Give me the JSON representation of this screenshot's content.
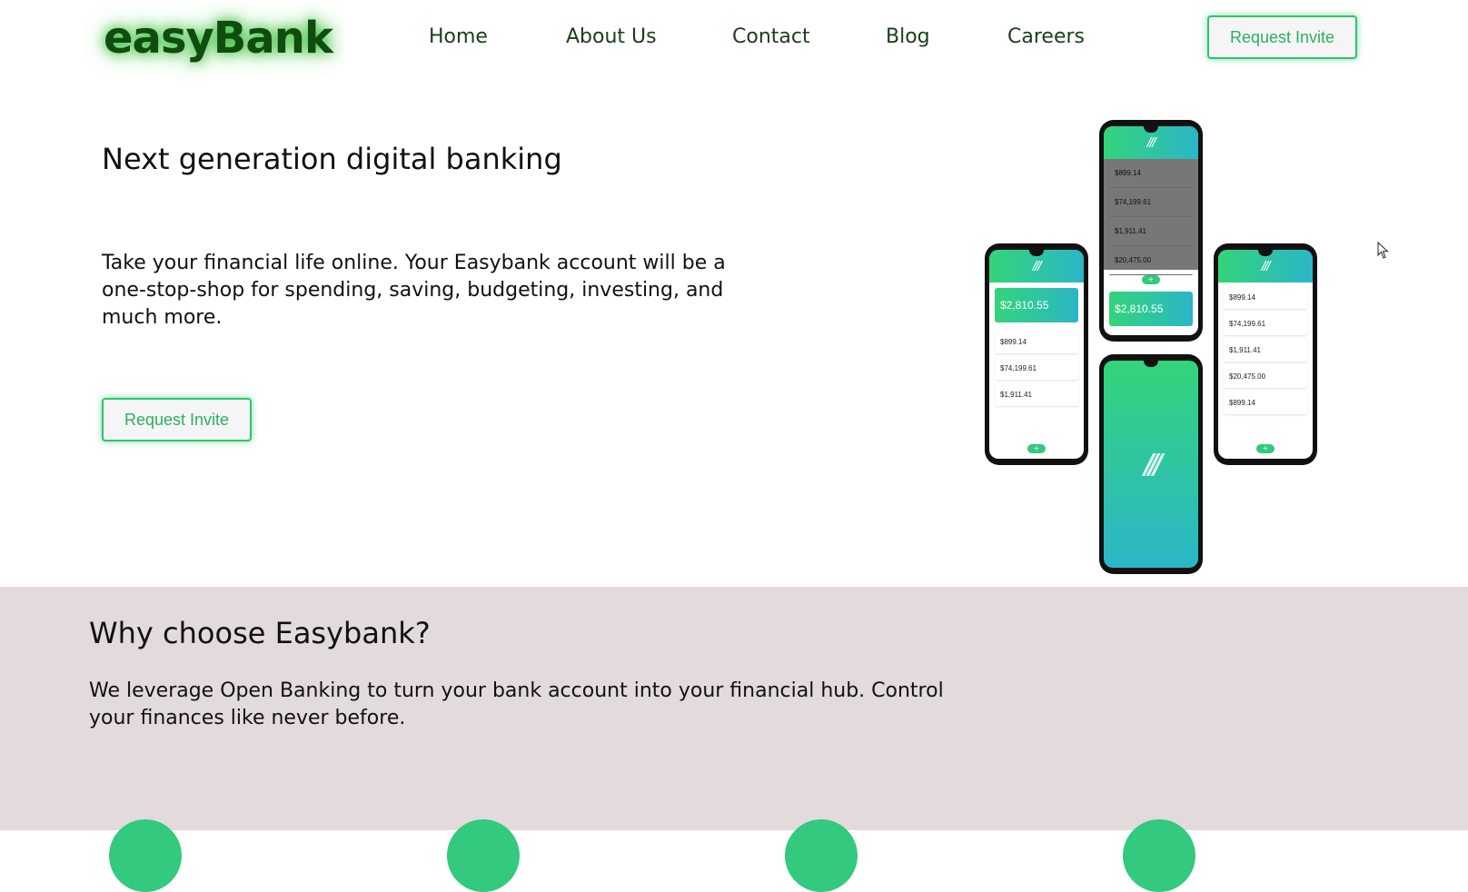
{
  "header": {
    "logo": "easyBank",
    "nav": [
      "Home",
      "About Us",
      "Contact",
      "Blog",
      "Careers"
    ],
    "cta_label": "Request Invite"
  },
  "hero": {
    "title": "Next generation digital banking",
    "text": "Take your financial life online. Your Easybank account will be a one-stop-shop for spending, saving, budgeting, investing, and much more.",
    "cta_label": "Request Invite"
  },
  "phones": {
    "total_balance": "$2,810.55",
    "accounts": [
      "$899.14",
      "$74,199.61",
      "$1,911.41",
      "$20,475.00",
      "$899.14"
    ]
  },
  "why": {
    "title": "Why choose Easybank?",
    "text": "We leverage Open Banking to turn your bank account into your financial hub. Control your finances like never before."
  },
  "colors": {
    "accent": "#33c97e",
    "logo": "#0f4d0f",
    "section_bg": "#e3dadb"
  }
}
